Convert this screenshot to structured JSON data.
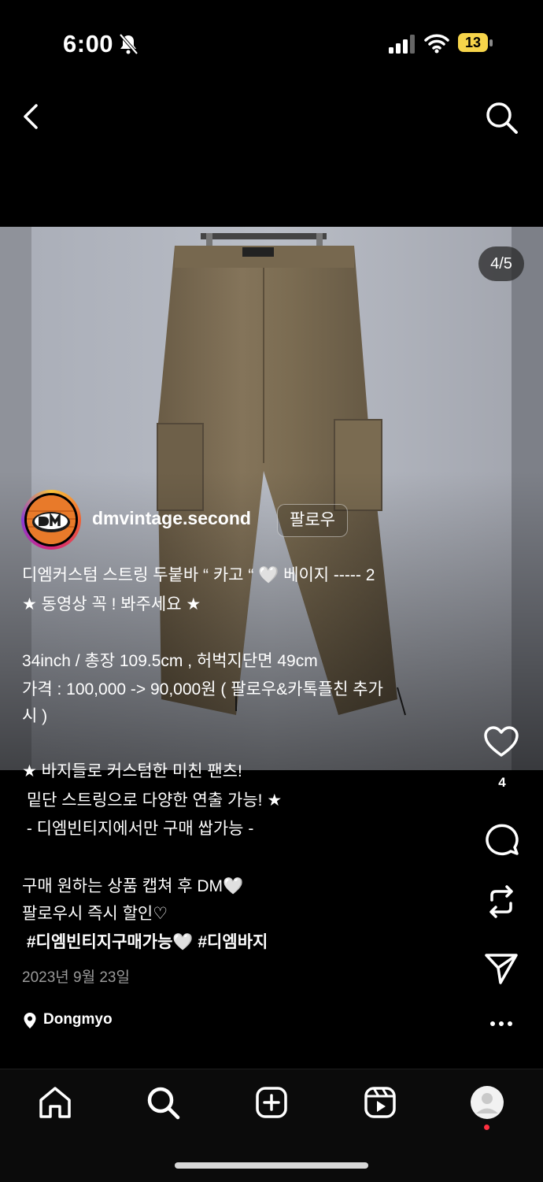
{
  "status_bar": {
    "time": "6:00",
    "battery": "13"
  },
  "post": {
    "image_counter": "4/5",
    "username": "dmvintage.second",
    "follow_label": "팔로우",
    "caption_lines": [
      "디엠커스텀 스트링 두붙바 “ 카고 “ 🤍 베이지 ----- 2",
      "★ 동영상 꼭 ! 봐주세요 ★",
      "",
      "34inch / 총장 109.5cm , 허벅지단면 49cm",
      "가격 : 100,000 -> 90,000원 ( 팔로우&카톡플친 추가",
      "시 )",
      "",
      "★ 바지들로 커스텀한 미친 팬츠!",
      " 밑단 스트링으로 다양한 연출 가능! ★",
      " - 디엠빈티지에서만 구매 쌉가능 -",
      "",
      "구매 원하는 상품 캡쳐 후 DM🤍",
      "팔로우시 즉시 할인♡",
      " #디엠빈티지구매가능🤍 #디엠바지"
    ],
    "date": "2023년 9월 23일",
    "location": "Dongmyo",
    "like_count": "4"
  },
  "icons": {
    "back": "chevron-left-icon",
    "search": "search-icon",
    "like": "heart-icon",
    "comment": "comment-icon",
    "repost": "repost-icon",
    "share": "send-icon",
    "more": "more-icon",
    "tabs": [
      "home-icon",
      "search-icon",
      "create-icon",
      "reels-icon",
      "profile-icon"
    ]
  },
  "colors": {
    "background": "#000000",
    "battery": "#f6d44a",
    "notification_dot": "#ff3040"
  }
}
